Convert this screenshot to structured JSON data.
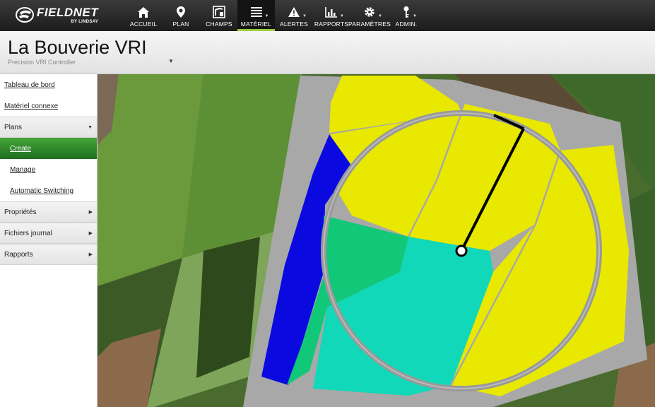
{
  "app": {
    "logo_brand": "FIELDNET",
    "logo_sub": "BY LINDSAY"
  },
  "nav": [
    {
      "label": "ACCUEIL",
      "icon": "home-icon"
    },
    {
      "label": "PLAN",
      "icon": "map-pin-icon"
    },
    {
      "label": "CHAMPS",
      "icon": "field-icon"
    },
    {
      "label": "MATÉRIEL",
      "icon": "equipment-list-icon",
      "active": true
    },
    {
      "label": "ALERTES",
      "icon": "warning-icon"
    },
    {
      "label": "RAPPORTS",
      "icon": "chart-icon"
    },
    {
      "label": "PARAMÈTRES",
      "icon": "gear-icon"
    },
    {
      "label": "ADMIN.",
      "icon": "key-icon"
    }
  ],
  "header": {
    "title": "La Bouverie VRI",
    "subtitle": "Precision VRI Controller"
  },
  "sidebar": {
    "dashboard": "Tableau de bord",
    "related": "Matériel connexe",
    "plans": "Plans",
    "create": "Create",
    "manage": "Manage",
    "auto_switching": "Automatic Switching",
    "properties": "Propriétés",
    "logs": "Fichiers journal",
    "reports": "Rapports"
  },
  "colors": {
    "accent_green": "#9ccc3c",
    "zone_yellow": "#e8e800",
    "zone_blue": "#0a0ae0",
    "zone_green": "#10c878",
    "zone_teal": "#10d8b8",
    "field_gray": "#a8a8a8"
  }
}
